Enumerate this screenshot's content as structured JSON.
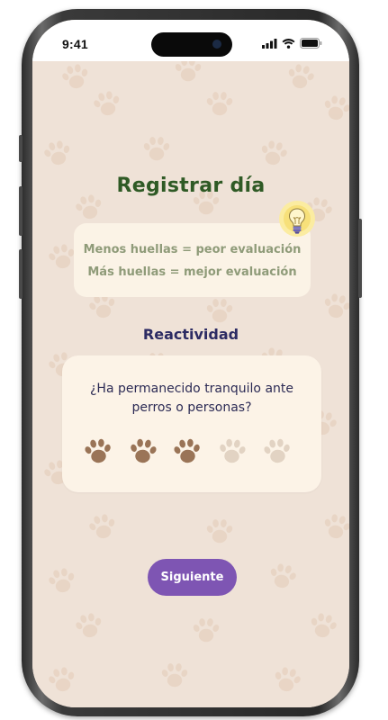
{
  "status_bar": {
    "time": "9:41"
  },
  "header": {
    "title": "Registrar día"
  },
  "info_card": {
    "line1": "Menos huellas = peor evaluación",
    "line2": "Más huellas = mejor evaluación",
    "icon": "lightbulb-icon"
  },
  "section": {
    "title": "Reactividad"
  },
  "question_card": {
    "question": "¿Ha permanecido tranquilo ante perros o personas?",
    "rating": {
      "selected": 3,
      "max": 5,
      "icon": "paw-icon"
    }
  },
  "footer": {
    "next_label": "Siguiente"
  },
  "colors": {
    "background": "#efe2d7",
    "title_green": "#2f5a25",
    "section_navy": "#2c2b63",
    "paw_active": "#9a7457",
    "paw_inactive": "#e2d3c3",
    "button_purple": "#7e55b3",
    "bulb_yellow": "#f7e48a"
  }
}
